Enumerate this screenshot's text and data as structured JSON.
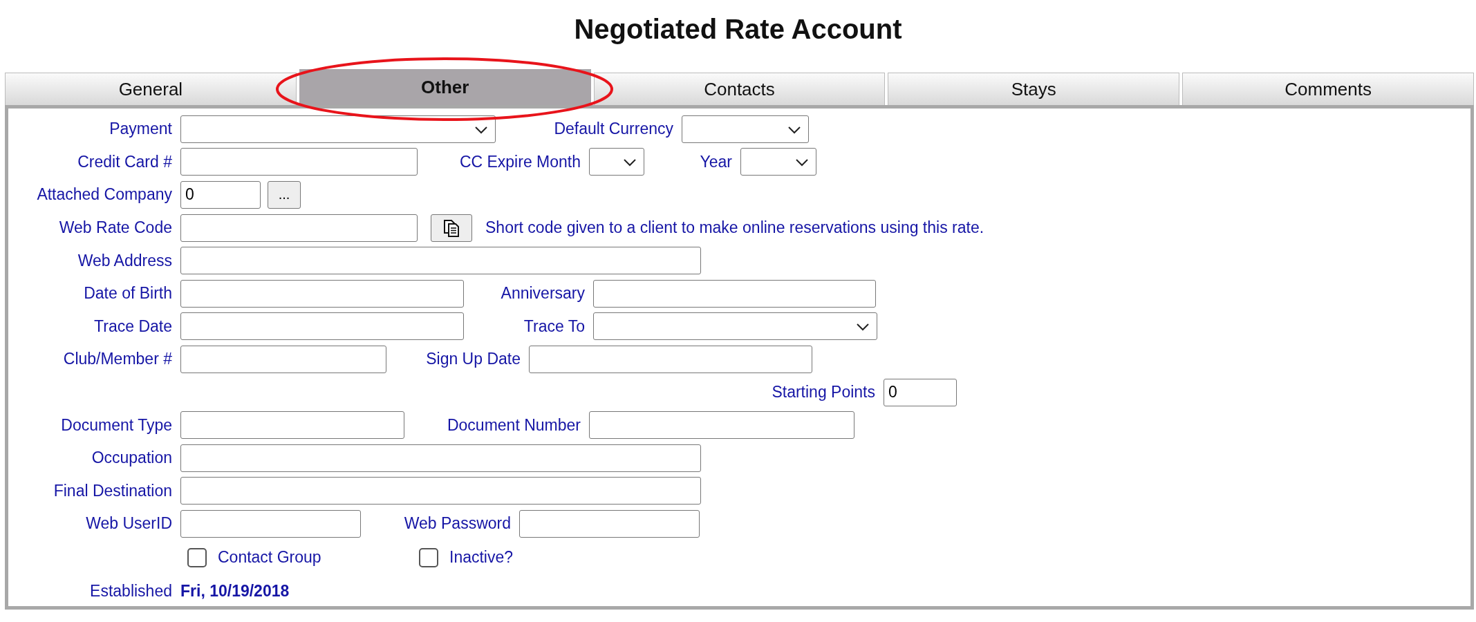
{
  "title": "Negotiated Rate Account",
  "tabs": [
    {
      "label": "General",
      "selected": false
    },
    {
      "label": "Other",
      "selected": true
    },
    {
      "label": "Contacts",
      "selected": false
    },
    {
      "label": "Stays",
      "selected": false
    },
    {
      "label": "Comments",
      "selected": false
    }
  ],
  "rows": [
    {
      "fields": [
        {
          "label": "Payment",
          "kind": "select"
        },
        {
          "label": "Default Currency",
          "kind": "select"
        }
      ]
    },
    {
      "fields": [
        {
          "label": "Credit Card #",
          "kind": "text"
        },
        {
          "label": "CC Expire Month",
          "kind": "select"
        },
        {
          "label": "Year",
          "kind": "select"
        }
      ]
    },
    {
      "fields": [
        {
          "label": "Attached Company",
          "kind": "lookup",
          "value": "0",
          "button": "..."
        }
      ]
    },
    {
      "fields": [
        {
          "label": "Web Rate Code",
          "kind": "copy",
          "note": "Short code given to a client to make online reservations using this rate."
        }
      ]
    },
    {
      "fields": [
        {
          "label": "Web Address",
          "kind": "text"
        }
      ]
    },
    {
      "fields": [
        {
          "label": "Date of Birth",
          "kind": "text"
        },
        {
          "label": "Anniversary",
          "kind": "text"
        }
      ]
    },
    {
      "fields": [
        {
          "label": "Trace Date",
          "kind": "text"
        },
        {
          "label": "Trace To",
          "kind": "select"
        }
      ]
    },
    {
      "fields": [
        {
          "label": "Club/Member #",
          "kind": "text"
        },
        {
          "label": "Sign Up Date",
          "kind": "text"
        }
      ]
    },
    {
      "fields": [
        {
          "label": "Starting Points",
          "kind": "text",
          "value": "0"
        }
      ]
    },
    {
      "fields": [
        {
          "label": "Document Type",
          "kind": "text"
        },
        {
          "label": "Document Number",
          "kind": "text"
        }
      ]
    },
    {
      "fields": [
        {
          "label": "Occupation",
          "kind": "text"
        }
      ]
    },
    {
      "fields": [
        {
          "label": "Final Destination",
          "kind": "text"
        }
      ]
    },
    {
      "fields": [
        {
          "label": "Web UserID",
          "kind": "text"
        },
        {
          "label": "Web Password",
          "kind": "text"
        }
      ]
    }
  ],
  "checkboxes": [
    {
      "label": "Contact Group",
      "checked": false
    },
    {
      "label": "Inactive?",
      "checked": false
    }
  ],
  "established": {
    "label": "Established",
    "value": "Fri, 10/19/2018"
  }
}
